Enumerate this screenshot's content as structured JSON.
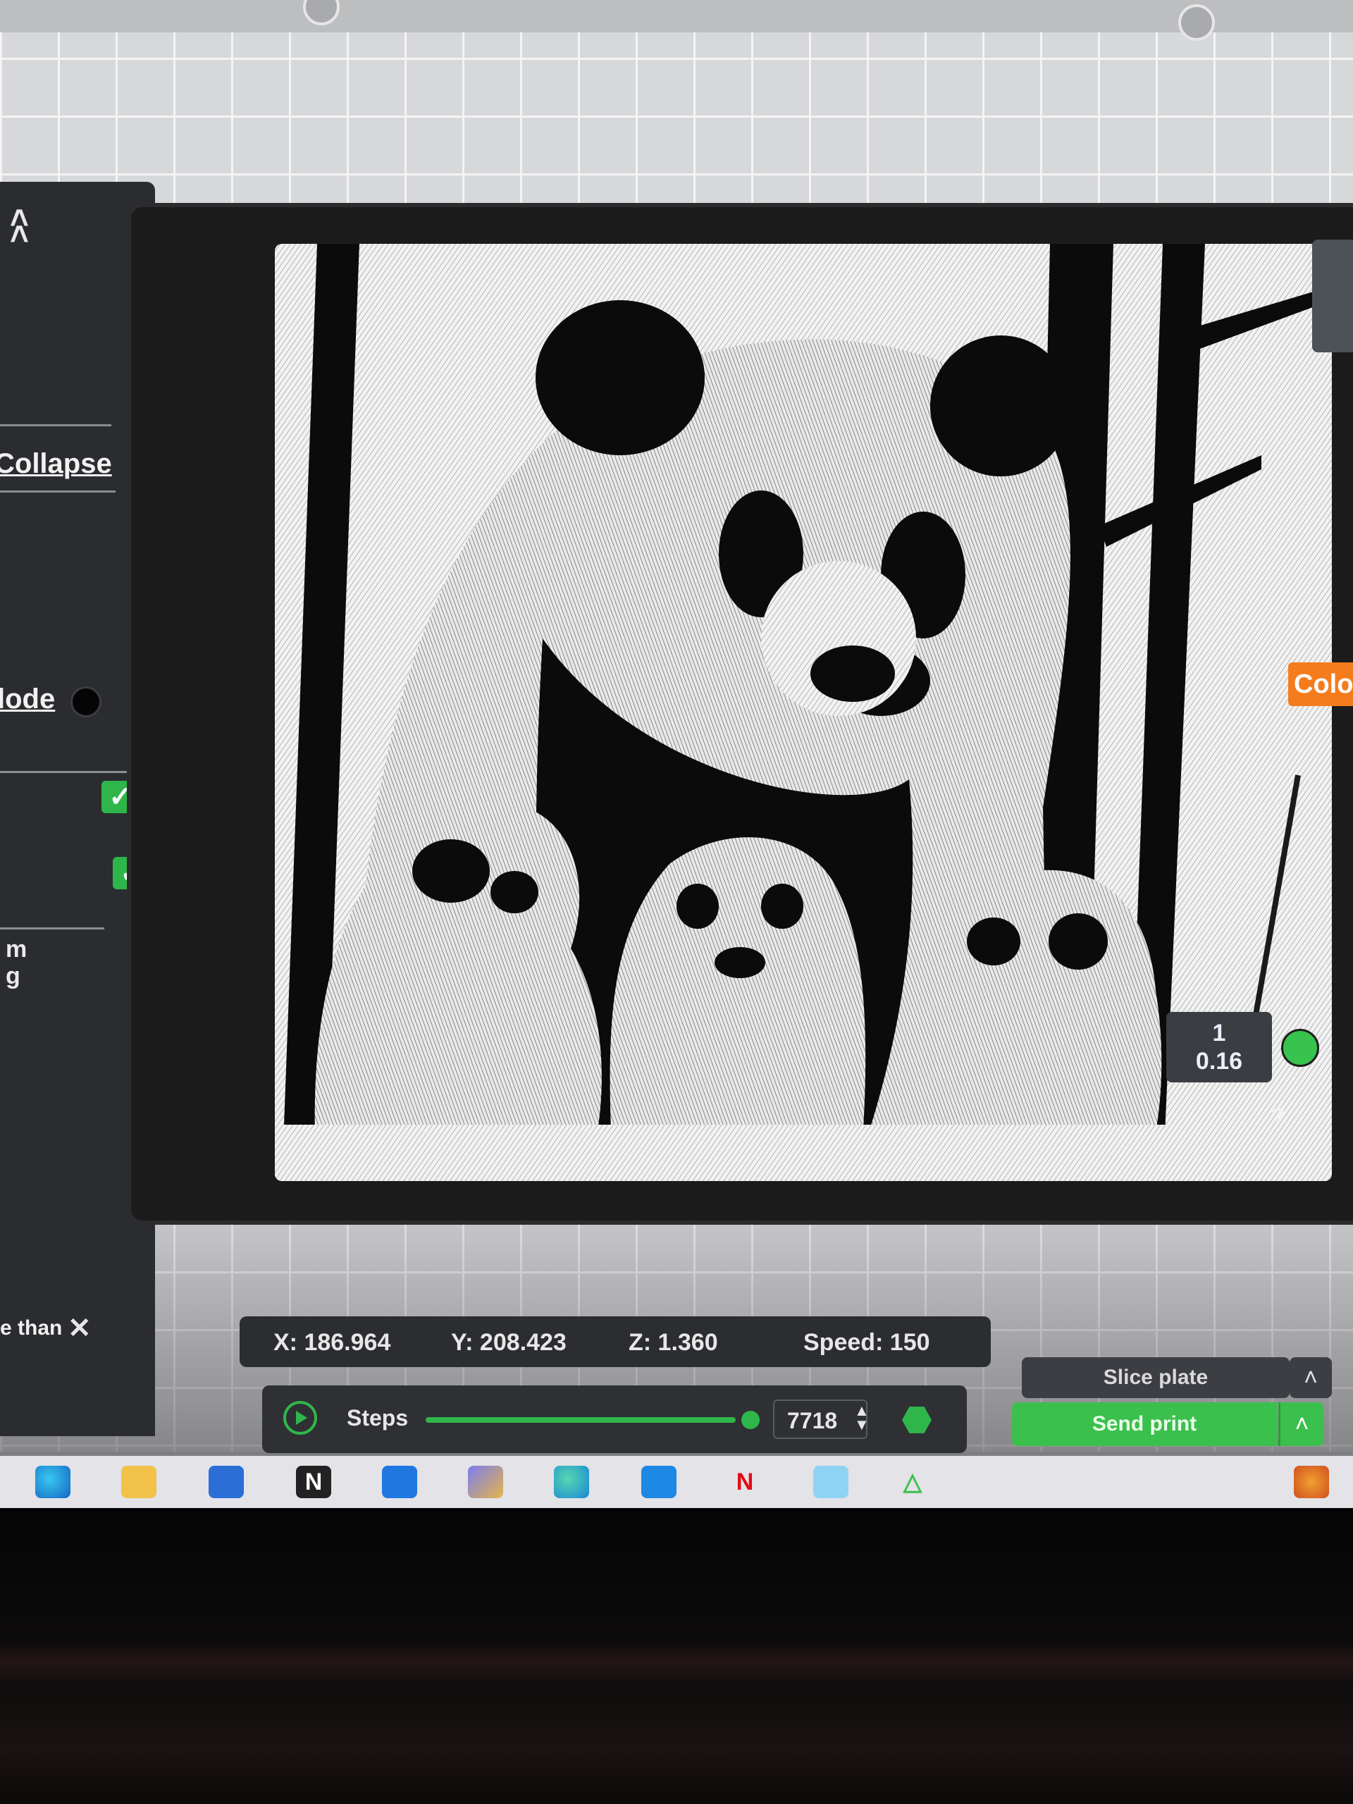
{
  "left_panel": {
    "collapse_label": "Collapse",
    "mode_label": "lode",
    "stat_line1": "m",
    "stat_line2": "g",
    "warning_text": "e than"
  },
  "coordinates": {
    "x": "X: 186.964",
    "y": "Y: 208.423",
    "z": "Z: 1.360",
    "speed": "Speed: 150"
  },
  "steps": {
    "label": "Steps",
    "value": "7718",
    "fraction": 0.99
  },
  "layer_slider": {
    "layer": "1",
    "height": "0.16",
    "help": "?"
  },
  "color_tab": "Color",
  "buttons": {
    "slice_plate": "Slice plate",
    "send_print": "Send print"
  },
  "taskbar_icons": [
    "edge-icon",
    "file-explorer-icon",
    "store-icon",
    "notion-icon",
    "media-player-icon",
    "photos-app-icon",
    "edge-dev-icon",
    "photos-icon",
    "netflix-icon",
    "app-icon",
    "slicer-app-icon",
    "system-tray-icon"
  ],
  "colors": {
    "accent_green": "#3bbf4d",
    "orange_tab": "#f57c1c",
    "panel_dark": "#2b2c2f"
  }
}
